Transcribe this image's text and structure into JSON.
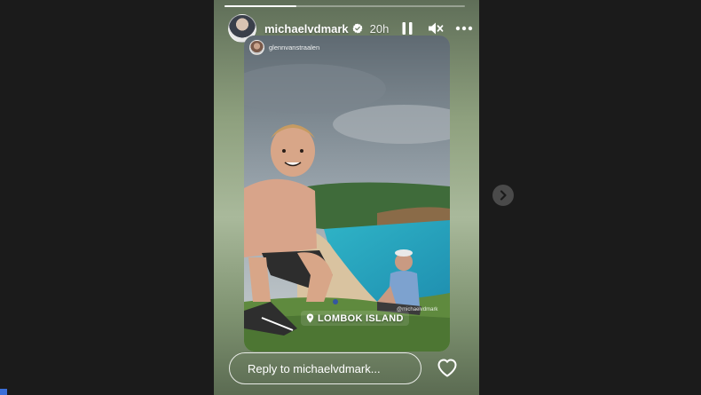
{
  "page": {
    "background": "#1b1b1b"
  },
  "story": {
    "progress": 0.3,
    "author": {
      "username": "michaelvdmark",
      "verified": true,
      "time_ago": "20h"
    },
    "controls": {
      "pause_icon": "pause-icon",
      "mute_icon": "speaker-muted-icon",
      "more_icon": "more-horizontal-icon"
    },
    "embedded_post": {
      "username": "glennvanstraalen",
      "location_sticker": "LOMBOK ISLAND",
      "mention_tag": "@michaelvdmark"
    },
    "reply": {
      "placeholder": "Reply to michaelvdmark..."
    },
    "like_icon": "heart-icon"
  },
  "navigation": {
    "next_icon": "chevron-right-icon"
  },
  "colors": {
    "story_gradient_top": "#5f6e58",
    "story_gradient_mid": "#a9b99b",
    "verified_badge": "#ffffff",
    "page_background": "#1b1b1b"
  }
}
